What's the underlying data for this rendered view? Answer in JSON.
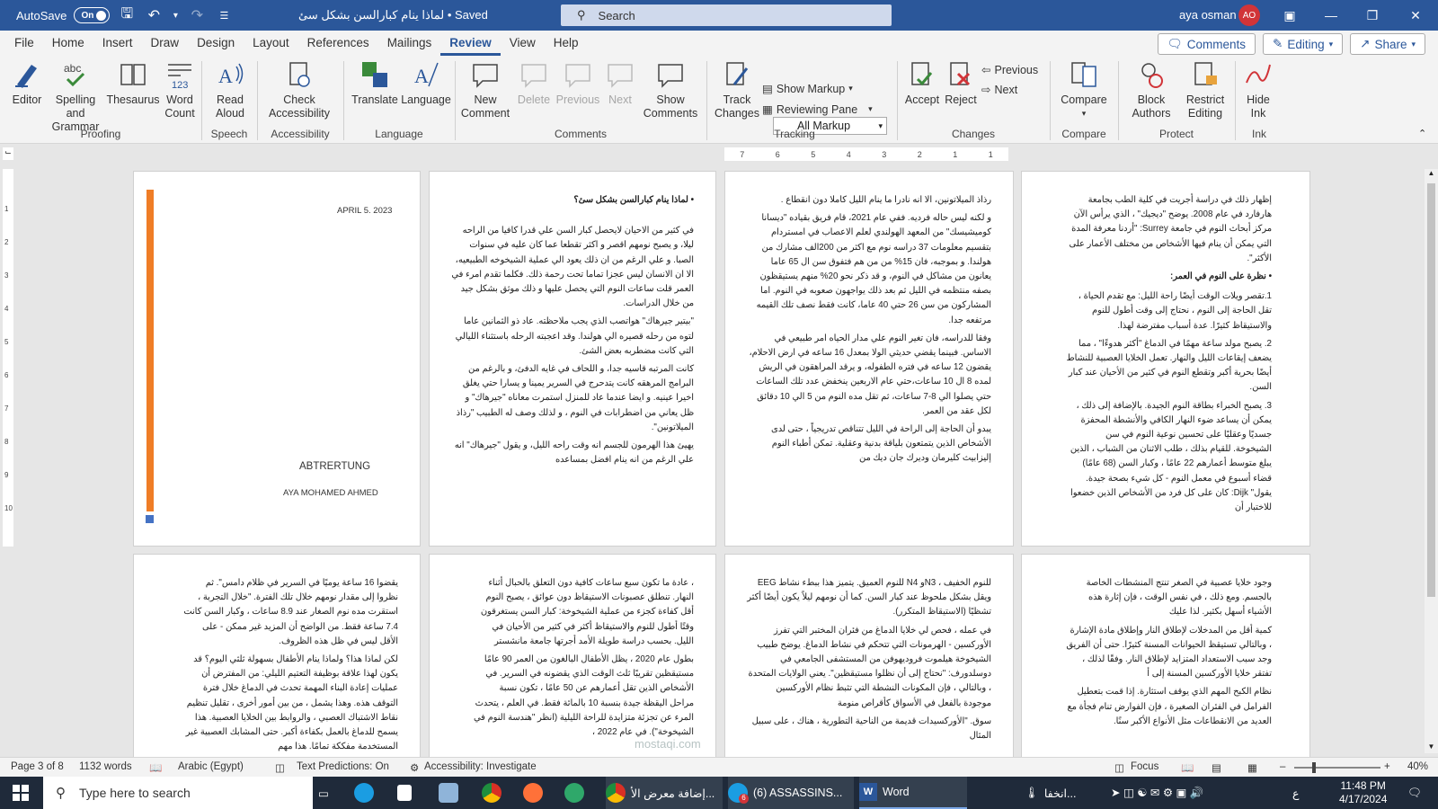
{
  "titlebar": {
    "autosave_label": "AutoSave",
    "toggle": "On",
    "doc_title": "لماذا ينام كبارالسن بشكل سئ • Saved",
    "search_placeholder": "Search",
    "user_name": "aya osman",
    "user_initials": "AO"
  },
  "tabs": [
    "File",
    "Home",
    "Insert",
    "Draw",
    "Design",
    "Layout",
    "References",
    "Mailings",
    "Review",
    "View",
    "Help"
  ],
  "active_tab": "Review",
  "menu_buttons": {
    "comments": "Comments",
    "editing": "Editing",
    "share": "Share"
  },
  "ribbon": {
    "editor": "Editor",
    "spelling": "Spelling and",
    "grammar": "Grammar",
    "thesaurus": "Thesaurus",
    "word_count_1": "Word",
    "word_count_2": "Count",
    "read_aloud_1": "Read",
    "read_aloud_2": "Aloud",
    "check_acc_1": "Check",
    "check_acc_2": "Accessibility",
    "translate": "Translate",
    "language": "Language",
    "new_comment_1": "New",
    "new_comment_2": "Comment",
    "delete": "Delete",
    "previous": "Previous",
    "next": "Next",
    "show_comments_1": "Show",
    "show_comments_2": "Comments",
    "track_changes_1": "Track",
    "track_changes_2": "Changes",
    "markup_select": "All Markup",
    "show_markup": "Show Markup",
    "reviewing_pane": "Reviewing Pane",
    "accept": "Accept",
    "reject": "Reject",
    "prev_change": "Previous",
    "next_change": "Next",
    "compare": "Compare",
    "block_authors_1": "Block",
    "block_authors_2": "Authors",
    "restrict_1": "Restrict",
    "restrict_2": "Editing",
    "hide_ink_1": "Hide",
    "hide_ink_2": "Ink",
    "groups": {
      "proofing": "Proofing",
      "speech": "Speech",
      "accessibility": "Accessibility",
      "language": "Language",
      "comments": "Comments",
      "tracking": "Tracking",
      "changes": "Changes",
      "compare": "Compare",
      "protect": "Protect",
      "ink": "Ink"
    }
  },
  "ruler_numbers": [
    "7",
    "6",
    "5",
    "4",
    "3",
    "2",
    "1",
    "1"
  ],
  "vruler_numbers": [
    "1",
    "2",
    "3",
    "4",
    "5",
    "6",
    "7",
    "8",
    "9",
    "10"
  ],
  "cover": {
    "date": "APRIL 5. 2023",
    "title": "ABTRERTUNG",
    "author": "AYA MOHAMED AHMED",
    "bar_color": "#ef7d26"
  },
  "page2": {
    "heading": "• لماذا ينام كبارالسن بشكل سئ؟",
    "paragraphs": [
      "في كثير من الاحيان لايحصل كبار السن علي قدرا كافيا من الراحه ليلا، و يصبح نومهم اقصر و اكثر تقطعا عما كان عليه في سنوات الصبا. و علي الرغم من ان ذلك يعود الي عملية الشيخوخه الطبيعيه، الا ان الانسان ليس عجزا تماما تحت رحمة ذلك. فكلما تقدم امرء في العمر قلت ساعات النوم التي يحصل عليها و ذلك موثق بشكل جيد من خلال الدراسات.",
      "\"بيتير جيرهاك\" هواتصب الذي يجب ملاحظته. عاد ذو الثمانين عاما لتوه من رحله قصيره الي هولندا. وقد اعجبته الرحله باستثناء الليالي التي كانت مضطربه بعض الشئ.",
      "كانت المرتبه قاسيه جدا، و اللحاف في غايه الدفئ، و بالرغم من البرامج المرهقه كانت يتدحرج في السرير يمينا و يسارا حتي يغلق اخيرا عينيه. و ايضا عندما عاد للمنزل استمرت معاناه \"جيرهاك\" و ظل يعاني من اضطرابات في النوم ، و لذلك وصف له الطبيب \"رذاذ الميلاتونين\".",
      "يهيئ هذا الهرمون للجسم انه وقت راحه الليل، و يقول \"جيرهاك\" انه علي الرغم من انه ينام افضل بمساعده"
    ]
  },
  "page3": {
    "paragraphs": [
      "رذاذ الميلاتونين، الا انه نادرا ما ينام الليل كاملا دون انقطاع .",
      "و لكنه ليس حاله فرديه. ففي عام 2021، قام فريق بقياده \"ديسانا كوميشيسك\" من المعهد الهولندي لعلم الاعصاب في امستردام بتقسيم معلومات 37 دراسه نوم مع اكثر من 200الف مشارك من هولندا. و بموجبه، فان 15% من من هم فتفوق سن ال 65 عاما يعانون من مشاكل في النوم، و قد ذكر نحو 20% منهم يستيقظون بصفه منتظمه في الليل ثم بعد ذلك يواجهون صعوبه في النوم. اما المشاركون من سن 26 حتي 40 عاما، كانت فقط نصف تلك القيمه مرتفعه جدا.",
      "وفقا للدراسه، فان تغير النوم علي مدار الحياه امر طبيعي في الاساس. فبينما يقضي حديثي الولا بمعدل 16 ساعه في ارض الاحلام، يقضون 12 ساعه في فتره الطفوله، و يرقد المراهقون في الريش لمده 8 ال 10 ساعات،حتي عام الاربعين ينخفض عدد تلك الساعات حتي يصلوا الي 8-7 ساعات، ثم تقل مده النوم من 5 الي 10 دقائق لكل عقد من العمر.",
      "يبدو أن الحاجة إلى الراحة في الليل تتناقص تدريجياً ، حتى لدى الأشخاص الذين يتمتعون بلياقة بدنية وعقلية. تمكن أطباء النوم إليزابيث كليرمان وديرك جان ديك من"
    ]
  },
  "page4": {
    "paragraphs": [
      "إظهار ذلك في دراسة أجريت في كلية الطب بجامعة هارفارد في عام 2008. يوضح \"ديجيك\" ، الذي يرأس الآن مركز أبحاث النوم في جامعة Surrey: \"أردنا معرفة المدة التي يمكن أن ينام فيها الأشخاص من مختلف الأعمار على الأكثر\"."
    ],
    "heading": "• نظرة على النوم في العمر:",
    "items": [
      "1.تقصر ويلات الوقت أيضًا راحة الليل: مع تقدم الحياة ، تقل الحاجة إلى النوم ، نحتاج إلى وقت أطول للنوم والاستيقاظ كثيرًا. عدة أسباب مفترضة لهذا.",
      "2. يصبح مولد ساعة مهمًا في الدماغ \"أكثر هدوءًا\" ، مما يضعف إيقاعات الليل والنهار. تعمل الخلايا العصبية للنشاط أيضًا بحرية أكبر وتقطع النوم في كثير من الأحيان عند كبار السن.",
      "3. يصبح الخبراء بطاقة النوم الجيدة. بالإضافة إلى ذلك ، يمكن أن يساعد ضوء النهار الكافي والأنشطة المحفزة جسديًا وعقليًا على تحسين نوعية النوم في سن الشيخوخة. للقيام بذلك ، طلب الاثنان من الشباب ، الذين يبلغ متوسط أعمارهم 22 عامًا ، وكبار السن (68 عامًا) قضاء أسبوع في معمل النوم - كل شيء بصحة جيدة. يقول\" Dijk: كان على كل فرد من الأشخاص الذين خضعوا للاختبار أن"
    ]
  },
  "page5": {
    "paragraphs": [
      "يقضوا 16 ساعة يوميًا في السرير في ظلام دامس\". ثم نظروا إلى مقدار نومهم خلال تلك الفترة. \"خلال التجربة ، استقرت مده نوم الصغار عند 8.9 ساعات ، وكبار السن كانت 7.4 ساعة فقط. من الواضح أن المزيد غير ممكن - على الأقل ليس في ظل هذه الظروف.",
      "لكن لماذا هذا؟ ولماذا ينام الأطفال بسهولة ثلثي اليوم؟ قد يكون لهذا علاقة بوظيفة التعتيم الليلي: من المفترض أن عمليات إعادة البناء المهمة تحدث في الدماغ خلال فترة التوقف هذه. وهذا يشمل ، من بين أمور أخرى ، تقليل تنظيم نقاط الاشتباك العصبي ، والروابط بين الخلايا العصبية. هذا يسمح للدماغ بالعمل بكفاءة أكبر. حتى المشابك العصبية غير المستخدمة مفككة تمامًا. هذا مهم"
    ]
  },
  "page6": {
    "paragraphs": [
      "، عادة ما تكون سبع ساعات كافية دون التعلق بالحبال أثناء النهار. تنطلق عصبونات الاستيقاظ دون عوائق ، يصبح النوم أقل كفاءة كجزء من عملية الشيخوخة: كبار السن يستغرقون وقتًا أطول للنوم والاستيقاظ أكثر في كثير من الأحيان في الليل. بحسب دراسة طويلة الأمد أجرتها جامعة مانشستر",
      "بطول عام 2020 ، يظل الأطفال البالغون من العمر 90 عامًا مستيقظين تقريبًا ثلث الوقت الذي يقضونه في السرير. في الأشخاص الذين تقل أعمارهم عن 50 عامًا ، تكون نسبة مراحل اليقظة جيدة بنسبة 10 بالمائة فقط. في العلم ، يتحدث المرء عن تجزئة متزايدة للراحة الليلية (انظر \"هندسة النوم في الشيخوخة\"). في عام 2022 ،"
    ]
  },
  "page7": {
    "paragraphs": [
      "للنوم الخفيف ، N3و N4 للنوم العميق. يتميز هذا ببطء نشاط EEG ويقل بشكل ملحوظ عند كبار السن. كما أن نومهم ليلاً يكون أيضًا أكثر تشظيًا (الاستيقاظ المتكرر).",
      "في عمله ، فحص لي خلايا الدماغ من فئران المختبر التي تفرز الأوركسين - الهرمونات التي تتحكم في نشاط الدماغ. يوضح طبيب الشيخوخة هيلموت فروديهوفن من المستشفى الجامعي في دوسلدورف: \"نحتاج إلى أن نظلوا مستيقظين\". يعني الولايات المتحدة ، وبالتالي ، فإن المكونات النشطة التي تثبط نظام الأوركسين موجودة بالفعل في الأسواق كأقراص منومة",
      "سوق. \"الأوركسيدات قديمة من الناحية التطورية ، هناك ، على سبيل المثال"
    ]
  },
  "page8": {
    "paragraphs": [
      "وجود خلايا عصبية في الصغر تنتج المنشطات الخاصة بالجسم. ومع ذلك ، في نفس الوقت ، فإن إثارة هذه الأشياء أسهل بكثير. لذا عليك",
      "كمية أقل من المدخلات لإطلاق النار وإطلاق مادة الإشارة ، وبالتالي تستيقظ الحيوانات المسنة كثيرًا. حتى أن الفريق وجد سبب الاستعداد المتزايد لإطلاق النار. وفقًا لذلك ، تفتقر خلايا الأوركسين المسنة إلى أ",
      "نظام الكبح المهم الذي يوقف استثارة. إذا قمت بتعطيل الفرامل في الفئران الصغيرة ، فإن الفوارض تنام فجأة مع العديد من الانقطاعات مثل الأنواع الأكبر سنًا."
    ]
  },
  "status": {
    "page": "Page 3 of 8",
    "words": "1132 words",
    "language": "Arabic (Egypt)",
    "text_predictions": "Text Predictions: On",
    "accessibility": "Accessibility: Investigate",
    "focus": "Focus",
    "zoom": "40%"
  },
  "taskbar": {
    "search_placeholder": "Type here to search",
    "chrome_task": "إضافة معرض الأ...",
    "assassins_task": "(6) ASSASSINS...",
    "word_task": "Word",
    "weather": "انخفا...",
    "lang": "ع",
    "time": "11:48 PM",
    "date": "4/17/2024",
    "badge": "6"
  },
  "watermark": "mostaqi.com"
}
